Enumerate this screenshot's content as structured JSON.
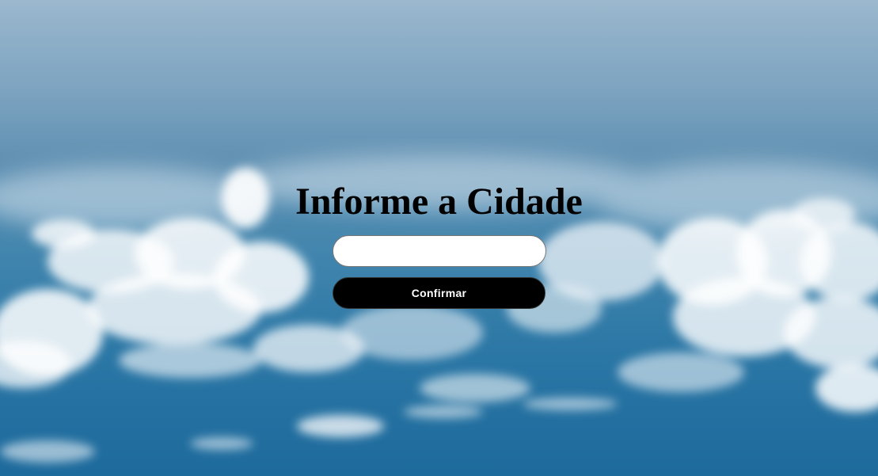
{
  "form": {
    "title": "Informe a Cidade",
    "city_input": {
      "value": "",
      "placeholder": ""
    },
    "confirm_label": "Confirmar"
  },
  "colors": {
    "sky_top": "#8fb0c9",
    "sky_bottom": "#1d6a9c",
    "cloud": "#ffffff",
    "button_bg": "#000000",
    "button_text": "#ffffff"
  }
}
